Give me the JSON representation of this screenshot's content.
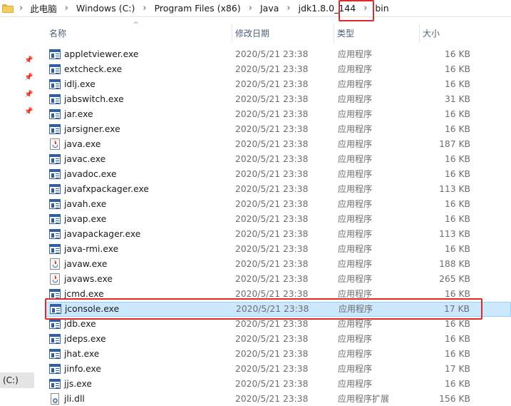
{
  "breadcrumb": {
    "items": [
      "此电脑",
      "Windows (C:)",
      "Program Files (x86)",
      "Java",
      "jdk1.8.0_144",
      "bin"
    ],
    "separator": "›"
  },
  "columns": {
    "name": "名称",
    "date": "修改日期",
    "type": "类型",
    "size": "大小"
  },
  "nav": {
    "drive_label": "(C:)"
  },
  "files": [
    {
      "name": "appletviewer.exe",
      "date": "2020/5/21 23:38",
      "type": "应用程序",
      "size": "16 KB",
      "icon": "exe-icon"
    },
    {
      "name": "extcheck.exe",
      "date": "2020/5/21 23:38",
      "type": "应用程序",
      "size": "16 KB",
      "icon": "exe-icon"
    },
    {
      "name": "idlj.exe",
      "date": "2020/5/21 23:38",
      "type": "应用程序",
      "size": "16 KB",
      "icon": "exe-icon"
    },
    {
      "name": "jabswitch.exe",
      "date": "2020/5/21 23:38",
      "type": "应用程序",
      "size": "31 KB",
      "icon": "exe-icon"
    },
    {
      "name": "jar.exe",
      "date": "2020/5/21 23:38",
      "type": "应用程序",
      "size": "16 KB",
      "icon": "exe-icon"
    },
    {
      "name": "jarsigner.exe",
      "date": "2020/5/21 23:38",
      "type": "应用程序",
      "size": "16 KB",
      "icon": "exe-icon"
    },
    {
      "name": "java.exe",
      "date": "2020/5/21 23:38",
      "type": "应用程序",
      "size": "187 KB",
      "icon": "java-icon"
    },
    {
      "name": "javac.exe",
      "date": "2020/5/21 23:38",
      "type": "应用程序",
      "size": "16 KB",
      "icon": "exe-icon"
    },
    {
      "name": "javadoc.exe",
      "date": "2020/5/21 23:38",
      "type": "应用程序",
      "size": "16 KB",
      "icon": "exe-icon"
    },
    {
      "name": "javafxpackager.exe",
      "date": "2020/5/21 23:38",
      "type": "应用程序",
      "size": "113 KB",
      "icon": "exe-icon"
    },
    {
      "name": "javah.exe",
      "date": "2020/5/21 23:38",
      "type": "应用程序",
      "size": "16 KB",
      "icon": "exe-icon"
    },
    {
      "name": "javap.exe",
      "date": "2020/5/21 23:38",
      "type": "应用程序",
      "size": "16 KB",
      "icon": "exe-icon"
    },
    {
      "name": "javapackager.exe",
      "date": "2020/5/21 23:38",
      "type": "应用程序",
      "size": "113 KB",
      "icon": "exe-icon"
    },
    {
      "name": "java-rmi.exe",
      "date": "2020/5/21 23:38",
      "type": "应用程序",
      "size": "16 KB",
      "icon": "exe-icon"
    },
    {
      "name": "javaw.exe",
      "date": "2020/5/21 23:38",
      "type": "应用程序",
      "size": "188 KB",
      "icon": "java-icon"
    },
    {
      "name": "javaws.exe",
      "date": "2020/5/21 23:38",
      "type": "应用程序",
      "size": "265 KB",
      "icon": "java-icon"
    },
    {
      "name": "jcmd.exe",
      "date": "2020/5/21 23:38",
      "type": "应用程序",
      "size": "16 KB",
      "icon": "exe-icon"
    },
    {
      "name": "jconsole.exe",
      "date": "2020/5/21 23:38",
      "type": "应用程序",
      "size": "17 KB",
      "icon": "exe-icon",
      "selected": true
    },
    {
      "name": "jdb.exe",
      "date": "2020/5/21 23:38",
      "type": "应用程序",
      "size": "16 KB",
      "icon": "exe-icon"
    },
    {
      "name": "jdeps.exe",
      "date": "2020/5/21 23:38",
      "type": "应用程序",
      "size": "16 KB",
      "icon": "exe-icon"
    },
    {
      "name": "jhat.exe",
      "date": "2020/5/21 23:38",
      "type": "应用程序",
      "size": "16 KB",
      "icon": "exe-icon"
    },
    {
      "name": "jinfo.exe",
      "date": "2020/5/21 23:38",
      "type": "应用程序",
      "size": "17 KB",
      "icon": "exe-icon"
    },
    {
      "name": "jjs.exe",
      "date": "2020/5/21 23:38",
      "type": "应用程序",
      "size": "16 KB",
      "icon": "exe-icon"
    },
    {
      "name": "jli.dll",
      "date": "2020/5/21 23:38",
      "type": "应用程序扩展",
      "size": "156 KB",
      "icon": "dll-icon"
    }
  ],
  "colors": {
    "selection_bg": "#cce8ff",
    "selection_border": "#99d1ff",
    "annotation_red": "#e02a2a",
    "header_text": "#4c607a"
  }
}
